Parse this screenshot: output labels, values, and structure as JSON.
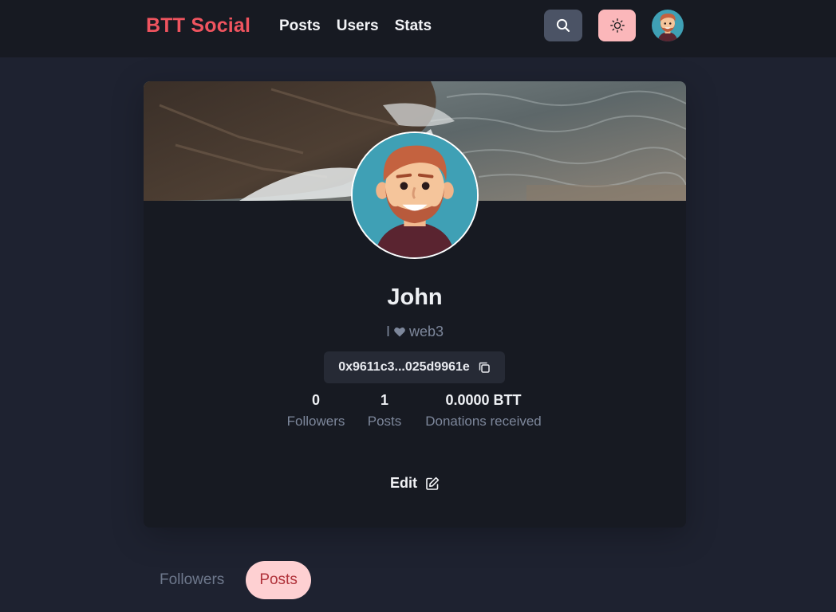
{
  "header": {
    "brand": "BTT Social",
    "nav": [
      "Posts",
      "Users",
      "Stats"
    ]
  },
  "profile": {
    "name": "John",
    "bio_prefix": "I",
    "bio_suffix": "web3",
    "address": "0x9611c3...025d9961e",
    "stats": [
      {
        "value": "0",
        "label": "Followers"
      },
      {
        "value": "1",
        "label": "Posts"
      },
      {
        "value": "0.0000 BTT",
        "label": "Donations received"
      }
    ],
    "edit_label": "Edit"
  },
  "tabs": [
    {
      "label": "Followers",
      "active": false
    },
    {
      "label": "Posts",
      "active": true
    }
  ],
  "colors": {
    "brand": "#f0545f",
    "active_tab_bg": "#fed0d2",
    "theme_button": "#fbb7ba"
  },
  "icons": {
    "search": "search-icon",
    "theme": "sun-icon",
    "copy": "copy-icon",
    "edit": "edit-icon",
    "bio_heart": "heart-icon"
  }
}
